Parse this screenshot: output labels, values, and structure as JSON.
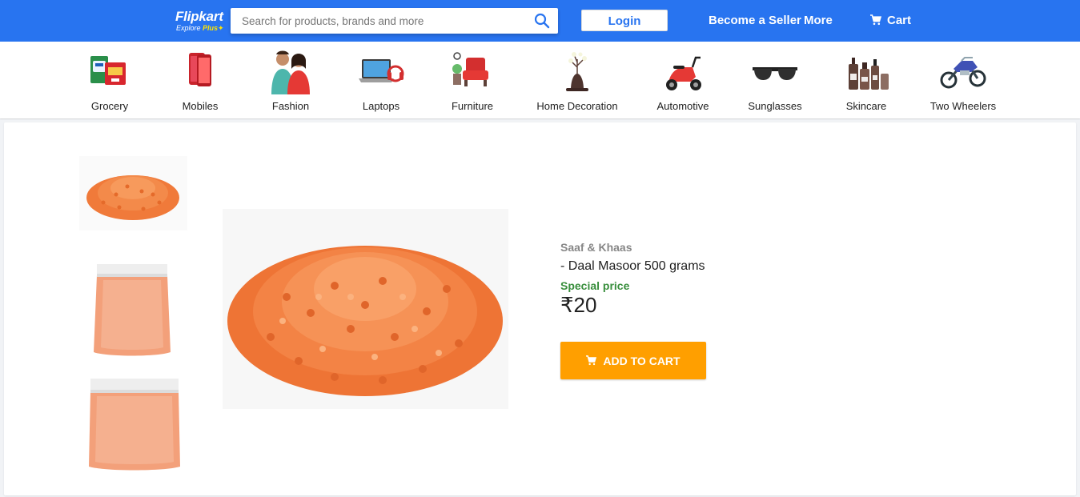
{
  "header": {
    "logo": {
      "title": "Flipkart",
      "subtitle_prefix": "Explore",
      "subtitle_plus": "Plus"
    },
    "search": {
      "placeholder": "Search for products, brands and more",
      "value": ""
    },
    "login_label": "Login",
    "seller_label": "Become a Seller",
    "more_label": "More",
    "cart_label": "Cart",
    "colors": {
      "brand_blue": "#2874f0",
      "logo_accent": "#ffe500"
    }
  },
  "categories": [
    {
      "label": "Grocery",
      "icon": "grocery-icon"
    },
    {
      "label": "Mobiles",
      "icon": "mobile-phone-icon"
    },
    {
      "label": "Fashion",
      "icon": "fashion-icon"
    },
    {
      "label": "Laptops",
      "icon": "laptop-icon"
    },
    {
      "label": "Furniture",
      "icon": "furniture-icon"
    },
    {
      "label": "Home Decoration",
      "icon": "home-decor-icon"
    },
    {
      "label": "Automotive",
      "icon": "scooter-icon"
    },
    {
      "label": "Sunglasses",
      "icon": "sunglasses-icon"
    },
    {
      "label": "Skincare",
      "icon": "skincare-icon"
    },
    {
      "label": "Two Wheelers",
      "icon": "motorcycle-icon"
    }
  ],
  "product": {
    "brand": "Saaf & Khaas",
    "title": "- Daal Masoor 500 grams",
    "special_label": "Special price",
    "price": "₹20",
    "add_to_cart_label": "ADD TO CART",
    "thumbnails": [
      "lentil-pile-image",
      "lentil-bag-image",
      "lentil-bag-image"
    ],
    "main_image": "lentil-pile-image",
    "colors": {
      "special_price": "#388e3c",
      "add_to_cart": "#ff9f00",
      "brand_gray": "#878787"
    }
  }
}
